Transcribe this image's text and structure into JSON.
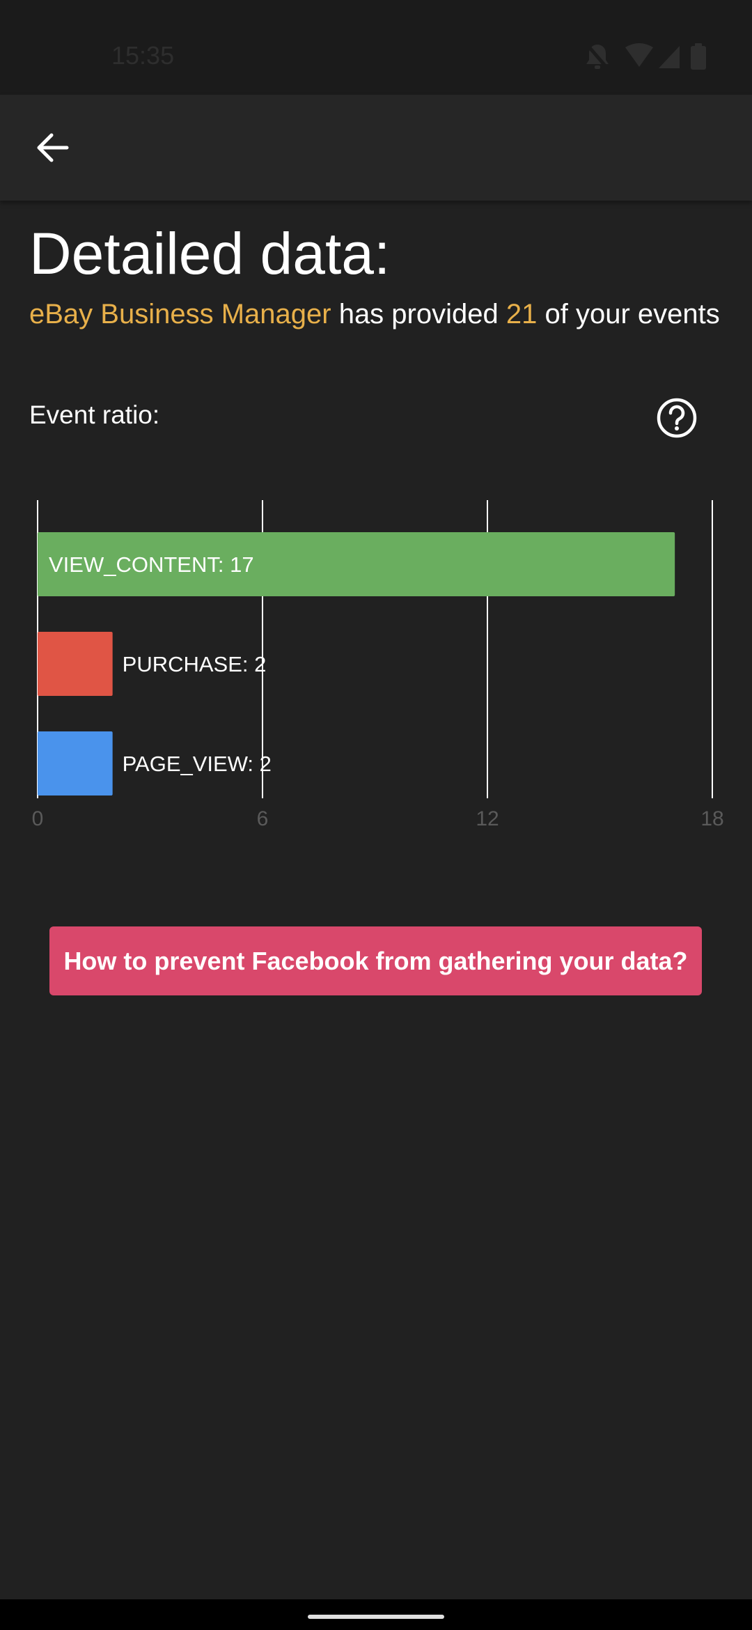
{
  "status_bar": {
    "time": "15:35",
    "icons": [
      "bell-off-icon",
      "wifi-icon",
      "signal-icon",
      "battery-icon"
    ]
  },
  "app_bar": {
    "back_icon": "arrow-left-icon"
  },
  "header": {
    "title": "Detailed data:",
    "summary_app": "eBay Business Manager",
    "summary_mid": " has provided ",
    "summary_count": "21",
    "summary_end": " of your events"
  },
  "event_ratio": {
    "label": "Event ratio:",
    "help_icon": "help-circle-icon"
  },
  "chart_data": {
    "type": "bar",
    "orientation": "horizontal",
    "categories": [
      "VIEW_CONTENT",
      "PURCHASE",
      "PAGE_VIEW"
    ],
    "values": [
      17,
      2,
      2
    ],
    "bar_labels": [
      "VIEW_CONTENT: 17",
      "PURCHASE: 2",
      "PAGE_VIEW: 2"
    ],
    "colors": [
      "#6aae5f",
      "#e05545",
      "#4a93ec"
    ],
    "xlim": [
      0,
      18
    ],
    "x_ticks": [
      "0",
      "6",
      "12",
      "18"
    ],
    "grid": true
  },
  "cta": {
    "label": "How to prevent Facebook from gathering your data?"
  },
  "colors": {
    "background": "#212121",
    "accent": "#e8b04a",
    "cta": "#d9486b"
  }
}
